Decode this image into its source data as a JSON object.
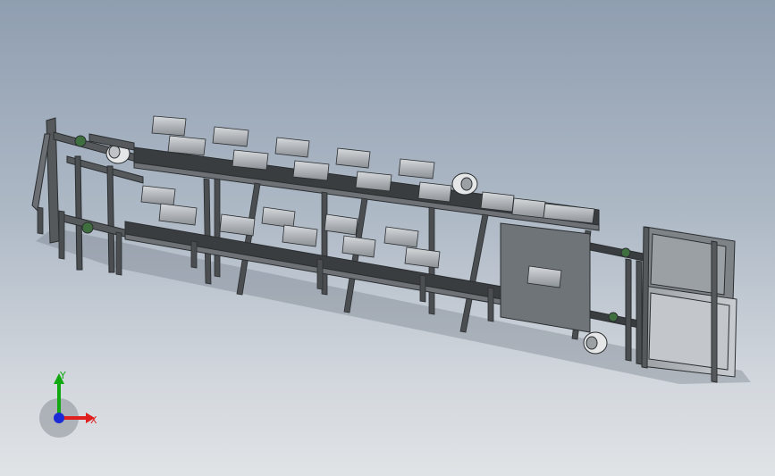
{
  "scene": {
    "triad": {
      "x_label": "X",
      "y_label": "Y",
      "x_color": "#e01f1f",
      "y_color": "#12a812",
      "z_color": "#1a2bd6"
    },
    "colors": {
      "frame": "#55595c",
      "frame_dark": "#2b2e30",
      "belt": "#3a3d40",
      "panel": "#bfc3c7",
      "panel_dark": "#8a8f93"
    }
  }
}
